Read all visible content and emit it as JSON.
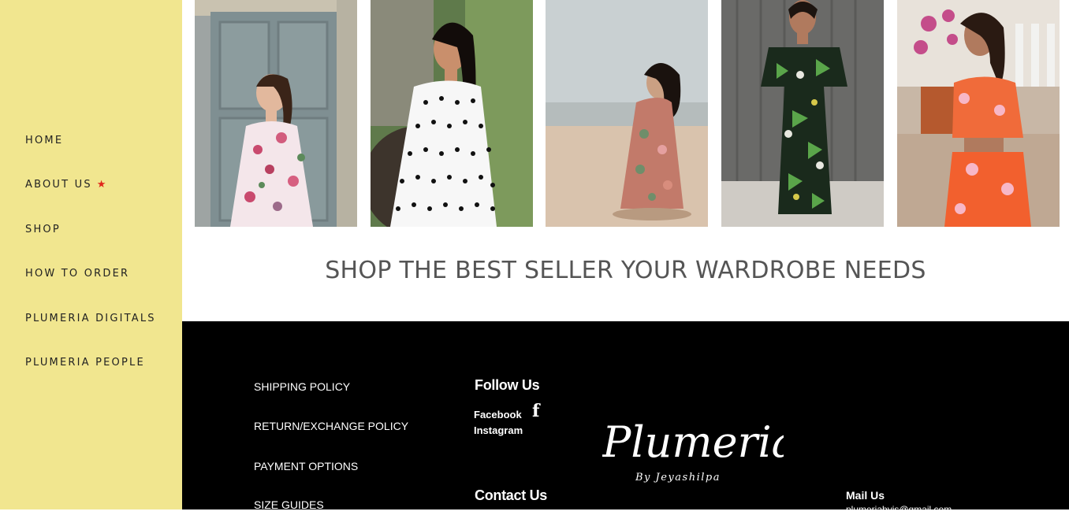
{
  "sidebar": {
    "items": [
      {
        "label": "HOME"
      },
      {
        "label": "ABOUT US",
        "badge": "★"
      },
      {
        "label": "SHOP"
      },
      {
        "label": "HOW TO ORDER"
      },
      {
        "label": "PLUMERIA DIGITALS"
      },
      {
        "label": "PLUMERIA PEOPLE"
      }
    ],
    "background": "#f1e68f",
    "badge_color": "#e0261b"
  },
  "gallery": {
    "photos": [
      {
        "desc": "woman-floral-dress-blue-door"
      },
      {
        "desc": "woman-polka-dot-dress"
      },
      {
        "desc": "woman-floral-dress-beach"
      },
      {
        "desc": "woman-tropical-print-jumpsuit"
      },
      {
        "desc": "woman-orange-floral-coord-set"
      }
    ]
  },
  "headline": "SHOP THE BEST SELLER YOUR WARDROBE NEEDS",
  "footer": {
    "policies": [
      {
        "label": "SHIPPING POLICY"
      },
      {
        "label": "RETURN/EXCHANGE POLICY"
      },
      {
        "label": "PAYMENT OPTIONS"
      },
      {
        "label": "SIZE GUIDES"
      }
    ],
    "follow_title": "Follow Us",
    "facebook_label": "Facebook",
    "instagram_label": "Instagram",
    "facebook_icon": "f",
    "contact_title": "Contact Us",
    "logo_main": "Plumeria",
    "logo_sub": "By Jeyashilpa",
    "mail_title": "Mail Us",
    "mail_value": "plumeriabyjs@gmail.com"
  }
}
